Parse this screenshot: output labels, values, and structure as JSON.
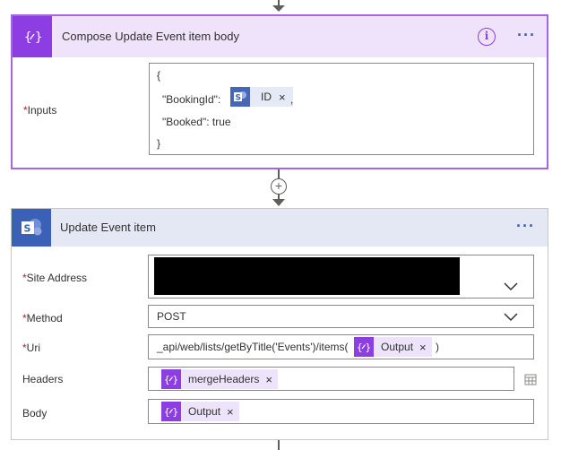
{
  "compose": {
    "title": "Compose Update Event item body",
    "inputs_label": "Inputs",
    "json_lines": [
      "{",
      "\"BookingId\":",
      "\"Booked\": true",
      "}"
    ],
    "comma": ",",
    "token_id": "ID",
    "remove_glyph": "×",
    "info_glyph": "i",
    "more_glyph": "···"
  },
  "connector": {
    "plus_glyph": "+"
  },
  "update": {
    "title": "Update Event item",
    "more_glyph": "···",
    "fields": {
      "site_address_label": "Site Address",
      "method_label": "Method",
      "method_value": "POST",
      "uri_label": "Uri",
      "uri_value": "_api/web/lists/getByTitle('Events')/items(",
      "uri_close": ")",
      "uri_token": "Output",
      "headers_label": "Headers",
      "headers_token": "mergeHeaders",
      "body_label": "Body",
      "body_token": "Output"
    }
  },
  "colors": {
    "compose_accent": "#8c3ee3",
    "compose_border": "#a566e3",
    "sharepoint_accent": "#3b61b7",
    "required": "#a4262c"
  }
}
